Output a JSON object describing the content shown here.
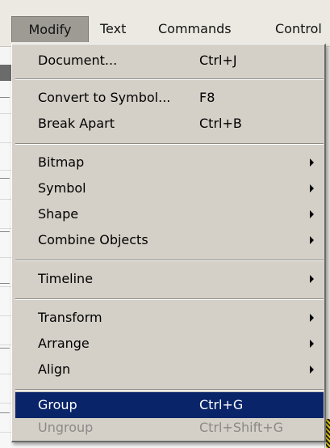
{
  "menubar": {
    "items": [
      {
        "label": "Modify"
      },
      {
        "label": "Text"
      },
      {
        "label": "Commands"
      },
      {
        "label": "Control"
      }
    ]
  },
  "dropdown": {
    "title": "Modify",
    "items": [
      {
        "label": "Document...",
        "shortcut": "Ctrl+J",
        "submenu": false
      },
      {
        "label": "Convert to Symbol...",
        "shortcut": "F8",
        "submenu": false
      },
      {
        "label": "Break Apart",
        "shortcut": "Ctrl+B",
        "submenu": false
      },
      {
        "label": "Bitmap",
        "shortcut": "",
        "submenu": true
      },
      {
        "label": "Symbol",
        "shortcut": "",
        "submenu": true
      },
      {
        "label": "Shape",
        "shortcut": "",
        "submenu": true
      },
      {
        "label": "Combine Objects",
        "shortcut": "",
        "submenu": true
      },
      {
        "label": "Timeline",
        "shortcut": "",
        "submenu": true
      },
      {
        "label": "Transform",
        "shortcut": "",
        "submenu": true
      },
      {
        "label": "Arrange",
        "shortcut": "",
        "submenu": true
      },
      {
        "label": "Align",
        "shortcut": "",
        "submenu": true
      },
      {
        "label": "Group",
        "shortcut": "Ctrl+G",
        "submenu": false,
        "state": "highlighted"
      },
      {
        "label": "Ungroup",
        "shortcut": "Ctrl+Shift+G",
        "submenu": false,
        "state": "disabled"
      }
    ]
  },
  "colors": {
    "menu_background": "#d4d0c8",
    "highlight_background": "#0a246a",
    "highlight_text": "#ffffff",
    "disabled_text": "#8b8a87"
  }
}
